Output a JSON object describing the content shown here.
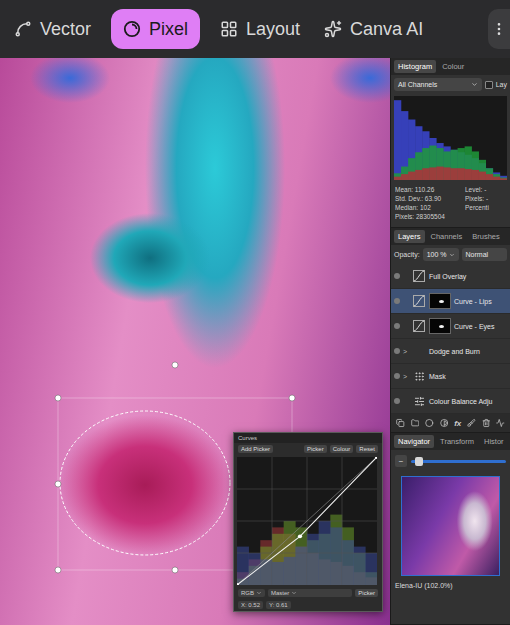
{
  "toolbar": {
    "tabs": [
      {
        "label": "Vector",
        "selected": false,
        "kind": "vector"
      },
      {
        "label": "Pixel",
        "selected": true,
        "kind": "pixel"
      },
      {
        "label": "Layout",
        "selected": false,
        "kind": "layout"
      },
      {
        "label": "Canva AI",
        "selected": false,
        "kind": "ai"
      }
    ]
  },
  "histogram_panel": {
    "tabs": [
      {
        "label": "Histogram",
        "selected": true
      },
      {
        "label": "Colour",
        "selected": false
      }
    ],
    "channel": "All Channels",
    "checkbox": {
      "label": "Lay",
      "checked": false
    },
    "chart": {
      "series": [
        {
          "name": "blue",
          "color": "#3c48d6",
          "values": [
            95,
            82,
            72,
            64,
            58,
            50,
            44,
            40,
            36,
            33,
            30,
            26,
            20,
            14,
            9,
            5
          ]
        },
        {
          "name": "green",
          "color": "#1f9a3a",
          "values": [
            8,
            16,
            26,
            33,
            38,
            41,
            38,
            34,
            36,
            38,
            40,
            34,
            24,
            14,
            7,
            3
          ]
        },
        {
          "name": "red",
          "color": "#b0303a",
          "values": [
            4,
            7,
            10,
            12,
            14,
            15,
            16,
            15,
            14,
            14,
            13,
            12,
            10,
            7,
            4,
            2
          ]
        }
      ]
    },
    "stats_left": [
      "Mean: 110.26",
      "Std. Dev.: 63.90",
      "Median: 102",
      "Pixels: 28305504"
    ],
    "stats_right": [
      "Level: -",
      "Pixels: -",
      "Percenti"
    ]
  },
  "layers_panel": {
    "tabs": [
      {
        "label": "Layers",
        "selected": true
      },
      {
        "label": "Channels",
        "selected": false
      },
      {
        "label": "Brushes",
        "selected": false
      }
    ],
    "opacity_label": "Opacity:",
    "opacity": "100 %",
    "blend": "Normal",
    "layers": [
      {
        "name": "Full Overlay",
        "kind": "curve",
        "selected": false,
        "has_mask": false,
        "expander": ""
      },
      {
        "name": "Curve - Lips",
        "kind": "curve",
        "selected": true,
        "has_mask": true,
        "expander": ""
      },
      {
        "name": "Curve - Eyes",
        "kind": "curve",
        "selected": false,
        "has_mask": true,
        "expander": ""
      },
      {
        "name": "Dodge and Burn",
        "kind": "group",
        "selected": false,
        "has_mask": false,
        "expander": ">"
      },
      {
        "name": "Mask",
        "kind": "pixel",
        "selected": false,
        "has_mask": false,
        "expander": ">"
      },
      {
        "name": "Colour Balance Adju",
        "kind": "balance",
        "selected": false,
        "has_mask": false,
        "expander": ""
      }
    ],
    "tools": [
      "copy",
      "folder",
      "mask",
      "adjust",
      "fx",
      "brush",
      "trash"
    ],
    "fx_label": "fx"
  },
  "navigator_panel": {
    "tabs": [
      {
        "label": "Navigator",
        "selected": true
      },
      {
        "label": "Transform",
        "selected": false
      },
      {
        "label": "Histor",
        "selected": false
      }
    ],
    "zoom_out": "−",
    "zoom_level": 0.08,
    "caption": "Elena-IU (102.0%)"
  },
  "curves_dialog": {
    "title": "Curves",
    "left_buttons": [
      "Add Picker"
    ],
    "right_buttons": [
      "Picker",
      "Colour",
      "Reset"
    ],
    "chart": {
      "series": [
        {
          "name": "red",
          "color": "#a83a3a",
          "values": [
            10,
            20,
            35,
            45,
            40,
            30,
            25,
            20,
            18,
            15,
            10,
            6
          ]
        },
        {
          "name": "green",
          "color": "#6a9a2a",
          "values": [
            5,
            15,
            30,
            40,
            50,
            45,
            35,
            40,
            55,
            45,
            25,
            10
          ]
        },
        {
          "name": "blue",
          "color": "#3a4a9a",
          "values": [
            30,
            25,
            20,
            18,
            22,
            30,
            40,
            50,
            45,
            35,
            30,
            25
          ]
        }
      ],
      "curve": [
        [
          0,
          0
        ],
        [
          0.45,
          0.38
        ],
        [
          1,
          1
        ]
      ]
    },
    "channel": "RGB",
    "mode": "Master",
    "picker": "Picker",
    "x_reading": "X: 0.52",
    "y_reading": "Y: 0.61"
  }
}
